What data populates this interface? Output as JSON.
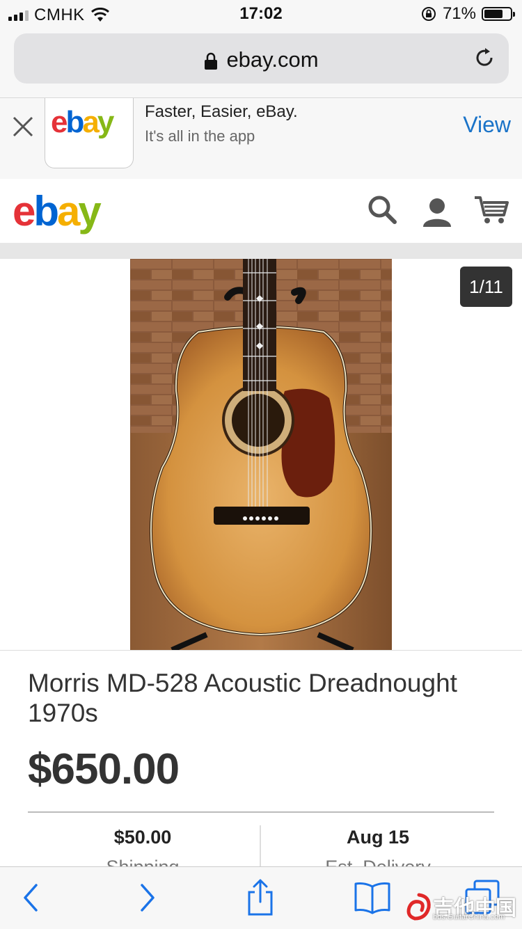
{
  "status": {
    "carrier": "CMHK",
    "time": "17:02",
    "battery": "71%",
    "battery_level": 0.71
  },
  "browser": {
    "url": "ebay.com"
  },
  "app_banner": {
    "headline": "Faster, Easier, eBay.",
    "subline": "It's all in the app",
    "view_label": "View",
    "logo": {
      "e": "e",
      "b": "b",
      "a": "a",
      "y": "y"
    }
  },
  "header": {
    "logo": {
      "e": "e",
      "b": "b",
      "a": "a",
      "y": "y"
    }
  },
  "gallery": {
    "counter": "1/11"
  },
  "listing": {
    "title": "Morris MD-528 Acoustic Dreadnought 1970s",
    "price": "$650.00",
    "shipping_value": "$50.00",
    "shipping_label": "Shipping",
    "delivery_value": "Aug 15",
    "delivery_label": "Est. Delivery"
  },
  "watermark": {
    "main": "吉他中国",
    "sub": "bbs.GuitarChina.com"
  },
  "colors": {
    "accent": "#1a73c8",
    "ebay_red": "#e53238",
    "ebay_blue": "#0064d2",
    "ebay_yellow": "#f5af02",
    "ebay_green": "#86b817"
  }
}
